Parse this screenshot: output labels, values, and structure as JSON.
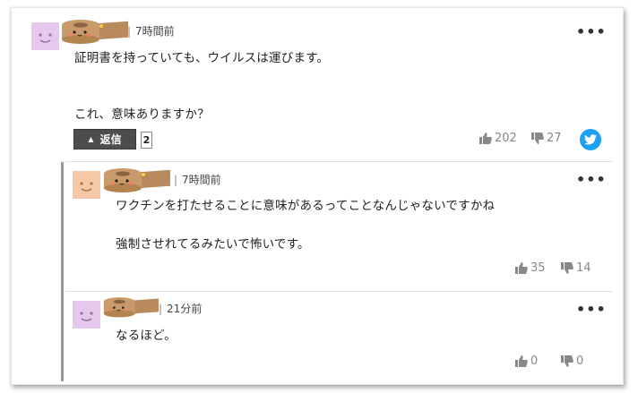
{
  "comments": [
    {
      "time": "7時間前",
      "lines": [
        "証明書を持っていても、ウイルスは運びます。",
        "これ、意味ありますか？"
      ],
      "reply_label": "返信",
      "reply_count": "2",
      "likes": "202",
      "dislikes": "27",
      "avatar_color": "#e5c8ec"
    },
    {
      "time": "7時間前",
      "lines": [
        "ワクチンを打たせることに意味があるってことなんじゃないですかね",
        "強制させれてるみたいで怖いです。"
      ],
      "likes": "35",
      "dislikes": "14",
      "avatar_color": "#f5c9a8"
    },
    {
      "time": "21分前",
      "lines": [
        "なるほど。"
      ],
      "likes": "0",
      "dislikes": "0",
      "avatar_color": "#e5c8ec"
    }
  ],
  "icons": {
    "more": "more-options-icon",
    "like": "thumbs-up-icon",
    "dislike": "thumbs-down-icon",
    "share": "twitter-icon"
  },
  "colors": {
    "twitter": "#1da1f2",
    "reply_button": "#4d4d4d",
    "vote": "#888888"
  }
}
